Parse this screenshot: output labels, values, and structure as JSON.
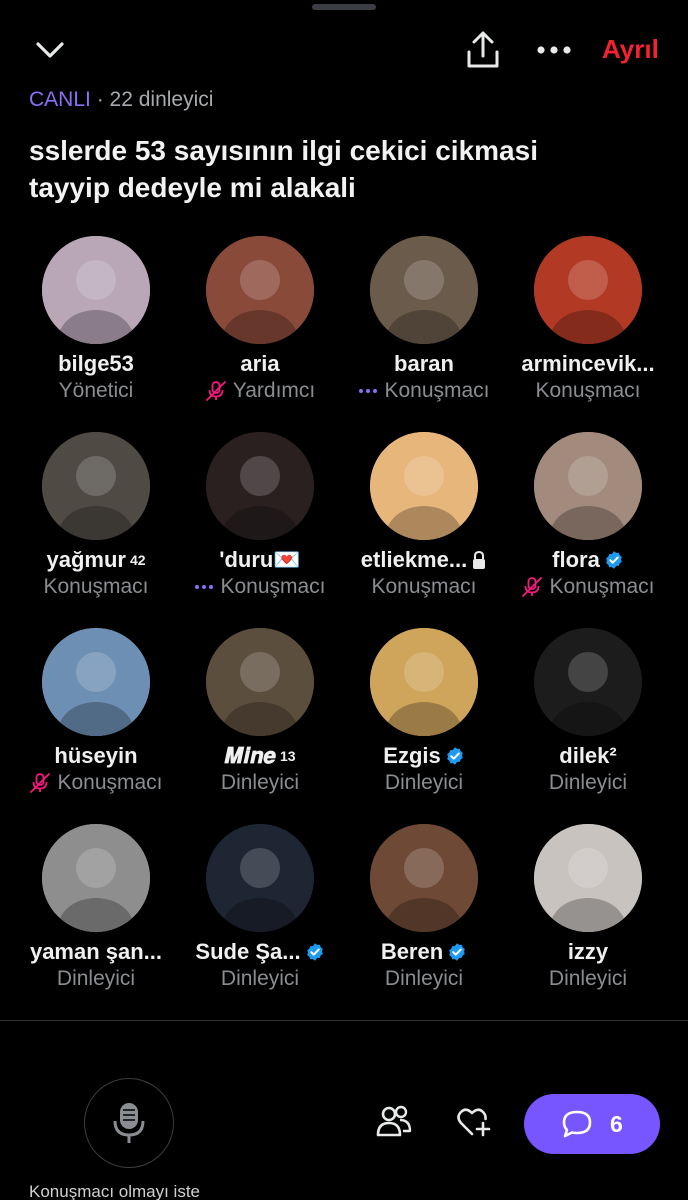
{
  "header": {
    "leave_label": "Ayrıl",
    "live_label": "CANLI",
    "listener_count": "· 22 dinleyici",
    "title_line1": "sslerde 53 sayısının ilgi cekici cikmasi",
    "title_line2": "tayyip dedeyle mi alakali"
  },
  "participants": [
    {
      "name": "bilge53",
      "role": "Yönetici",
      "status": "none",
      "verified": false,
      "avatar_color": "#b9a7b7"
    },
    {
      "name": "aria",
      "role": "Yardımcı",
      "status": "muted",
      "verified": false,
      "avatar_color": "#8a4a3a"
    },
    {
      "name": "baran",
      "role": "Konuşmacı",
      "status": "speaking",
      "verified": false,
      "avatar_color": "#6b5b4b"
    },
    {
      "name": "armincevik...",
      "role": "Konuşmacı",
      "status": "none",
      "verified": false,
      "avatar_color": "#b23a24"
    },
    {
      "name": "yağmur",
      "name_sup": "42",
      "role": "Konuşmacı",
      "status": "none",
      "verified": false,
      "avatar_color": "#4f4a44"
    },
    {
      "name": "'duru💌",
      "role": "Konuşmacı",
      "status": "speaking",
      "verified": false,
      "avatar_color": "#2a2020"
    },
    {
      "name": "etliekme...",
      "role": "Konuşmacı",
      "status": "none",
      "verified": false,
      "locked": true,
      "avatar_color": "#e7b67b"
    },
    {
      "name": "flora",
      "role": "Konuşmacı",
      "status": "muted",
      "verified": true,
      "avatar_color": "#a28a7c"
    },
    {
      "name": "hüseyin",
      "role": "Konuşmacı",
      "status": "muted",
      "verified": false,
      "avatar_color": "#6d8fb4"
    },
    {
      "name": "𝑴𝒊𝒏𝒆",
      "name_sup": "13",
      "role": "Dinleyici",
      "status": "none",
      "verified": false,
      "avatar_color": "#5c4e3c"
    },
    {
      "name": "Ezgis",
      "role": "Dinleyici",
      "status": "none",
      "verified": true,
      "avatar_color": "#cfa55c"
    },
    {
      "name": "dilek²",
      "role": "Dinleyici",
      "status": "none",
      "verified": false,
      "avatar_color": "#1c1c1c"
    },
    {
      "name": "yaman şan...",
      "role": "Dinleyici",
      "status": "none",
      "verified": false,
      "avatar_color": "#8e8e8e"
    },
    {
      "name": "Sude Şa...",
      "role": "Dinleyici",
      "status": "none",
      "verified": true,
      "avatar_color": "#1e2533"
    },
    {
      "name": "Beren",
      "role": "Dinleyici",
      "status": "none",
      "verified": true,
      "avatar_color": "#6e4a36"
    },
    {
      "name": "izzy",
      "role": "Dinleyici",
      "status": "none",
      "verified": false,
      "avatar_color": "#c9c3bf"
    }
  ],
  "footer": {
    "mic_request_label": "Konuşmacı olmayı iste",
    "chat_count": "6"
  },
  "colors": {
    "accent": "#7856ff",
    "live": "#8b6ff5",
    "leave": "#f4212e",
    "verified": "#1d9bf0",
    "muted": "#f91880"
  },
  "icons": {
    "collapse": "chevron-down-icon",
    "share": "share-icon",
    "more": "more-icon",
    "mic": "microphone-icon",
    "people": "people-icon",
    "heart": "heart-plus-icon",
    "chat": "chat-bubble-icon"
  }
}
